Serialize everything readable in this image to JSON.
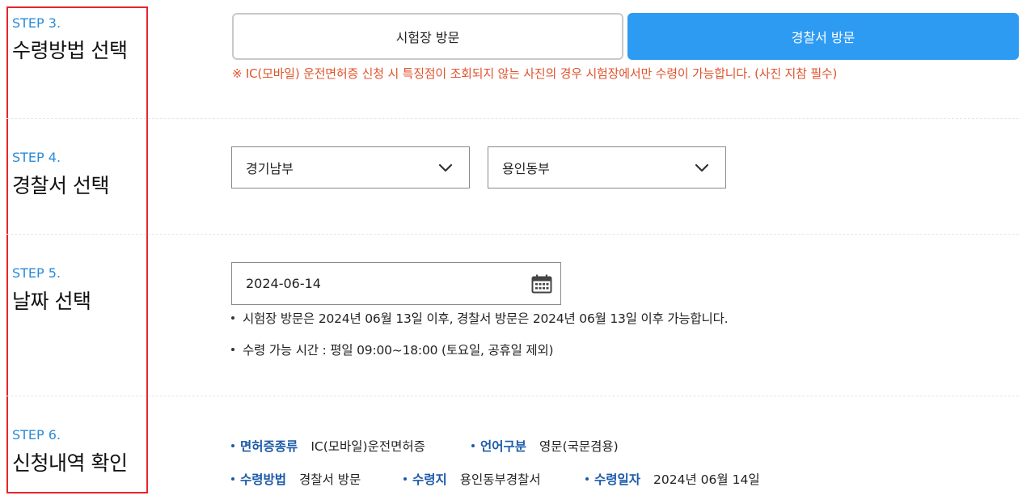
{
  "step3": {
    "number": "STEP 3.",
    "title": "수령방법 선택",
    "options": [
      "시험장 방문",
      "경찰서 방문"
    ],
    "warning": "※ IC(모바일) 운전면허증 신청 시 특징점이 조회되지 않는 사진의 경우 시험장에서만 수령이 가능합니다. (사진 지참 필수)"
  },
  "step4": {
    "number": "STEP 4.",
    "title": "경찰서 선택",
    "region": "경기남부",
    "station": "용인동부"
  },
  "step5": {
    "number": "STEP 5.",
    "title": "날짜 선택",
    "date": "2024-06-14",
    "notes": [
      "시험장 방문은 2024년 06월 13일 이후, 경찰서 방문은 2024년 06월 13일 이후 가능합니다.",
      "수령 가능 시간 : 평일 09:00~18:00 (토요일, 공휴일 제외)"
    ]
  },
  "step6": {
    "number": "STEP 6.",
    "title": "신청내역 확인",
    "summary": {
      "license_type_label": "면허증종류",
      "license_type_value": "IC(모바일)운전면허증",
      "language_label": "언어구분",
      "language_value": "영문(국문겸용)",
      "method_label": "수령방법",
      "method_value": "경찰서 방문",
      "place_label": "수령지",
      "place_value": "용인동부경찰서",
      "date_label": "수령일자",
      "date_value": "2024년 06월 14일"
    }
  },
  "colors": {
    "accent": "#2e9bf3",
    "step_label": "#2a8bd8",
    "warning": "#e0532e",
    "summary_key": "#1b5aa8",
    "highlight_frame": "#e8242a"
  },
  "icons": [
    "chevron-down-icon",
    "calendar-icon"
  ]
}
